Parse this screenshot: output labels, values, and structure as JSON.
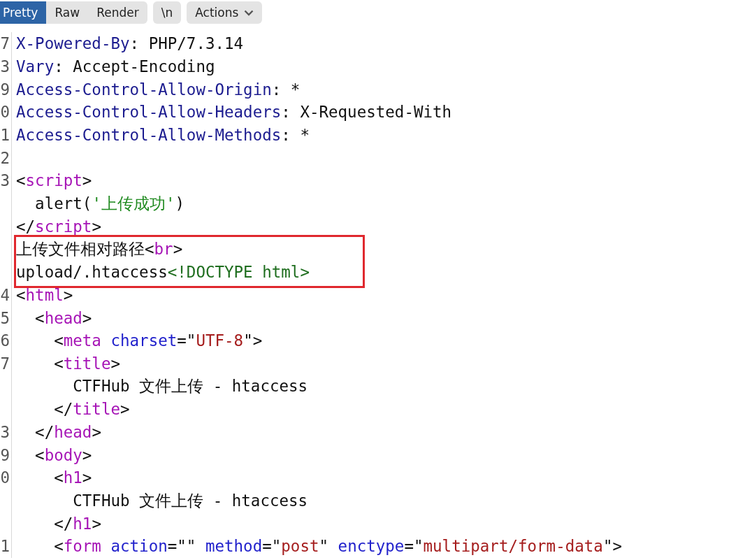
{
  "toolbar": {
    "view_tabs": [
      {
        "label": "Pretty",
        "selected": true
      },
      {
        "label": "Raw",
        "selected": false
      },
      {
        "label": "Render",
        "selected": false
      }
    ],
    "newline_button": "\\n",
    "actions_button": "Actions"
  },
  "lines": [
    {
      "number": "7",
      "boxed": false,
      "tokens": [
        {
          "kind": "header",
          "text": "X-Powered-By"
        },
        {
          "kind": "plain",
          "text": ": PHP/7.3.14"
        }
      ]
    },
    {
      "number": "3",
      "boxed": false,
      "tokens": [
        {
          "kind": "header",
          "text": "Vary"
        },
        {
          "kind": "plain",
          "text": ": Accept-Encoding"
        }
      ]
    },
    {
      "number": "9",
      "boxed": false,
      "tokens": [
        {
          "kind": "header",
          "text": "Access-Control-Allow-Origin"
        },
        {
          "kind": "plain",
          "text": ": *"
        }
      ]
    },
    {
      "number": "0",
      "boxed": false,
      "tokens": [
        {
          "kind": "header",
          "text": "Access-Control-Allow-Headers"
        },
        {
          "kind": "plain",
          "text": ": X-Requested-With"
        }
      ]
    },
    {
      "number": "1",
      "boxed": false,
      "tokens": [
        {
          "kind": "header",
          "text": "Access-Control-Allow-Methods"
        },
        {
          "kind": "plain",
          "text": ": *"
        }
      ]
    },
    {
      "number": "2",
      "boxed": false
    },
    {
      "number": "3",
      "boxed": false,
      "tokens": [
        {
          "kind": "plain",
          "text": "<"
        },
        {
          "kind": "tag",
          "text": "script"
        },
        {
          "kind": "plain",
          "text": ">"
        }
      ]
    },
    {
      "boxed": false,
      "tokens": [
        {
          "kind": "plain",
          "text": "  alert("
        },
        {
          "kind": "jsstr",
          "text": "'上传成功'"
        },
        {
          "kind": "plain",
          "text": ")"
        }
      ]
    },
    {
      "boxed": false,
      "tokens": [
        {
          "kind": "plain",
          "text": "</"
        },
        {
          "kind": "tag",
          "text": "script"
        },
        {
          "kind": "plain",
          "text": ">"
        }
      ]
    },
    {
      "boxed": true,
      "tokens": [
        {
          "kind": "plain",
          "text": "上传文件相对路径<"
        },
        {
          "kind": "tag",
          "text": "br"
        },
        {
          "kind": "plain",
          "text": ">"
        }
      ]
    },
    {
      "boxed": true,
      "tokens": [
        {
          "kind": "plain",
          "text": "upload/.htaccess"
        },
        {
          "kind": "doctype",
          "text": "<!DOCTYPE html>"
        }
      ]
    },
    {
      "number": "4",
      "boxed": false,
      "tokens": [
        {
          "kind": "plain",
          "text": "<"
        },
        {
          "kind": "tag",
          "text": "html"
        },
        {
          "kind": "plain",
          "text": ">"
        }
      ]
    },
    {
      "number": "5",
      "boxed": false,
      "tokens": [
        {
          "kind": "plain",
          "text": "  <"
        },
        {
          "kind": "tag",
          "text": "head"
        },
        {
          "kind": "plain",
          "text": ">"
        }
      ]
    },
    {
      "number": "6",
      "boxed": false,
      "tokens": [
        {
          "kind": "plain",
          "text": "    <"
        },
        {
          "kind": "tag",
          "text": "meta"
        },
        {
          "kind": "attr",
          "text": " charset"
        },
        {
          "kind": "plain",
          "text": "=\""
        },
        {
          "kind": "value",
          "text": "UTF-8"
        },
        {
          "kind": "plain",
          "text": "\">"
        }
      ]
    },
    {
      "number": "7",
      "boxed": false,
      "tokens": [
        {
          "kind": "plain",
          "text": "    <"
        },
        {
          "kind": "tag",
          "text": "title"
        },
        {
          "kind": "plain",
          "text": ">"
        }
      ]
    },
    {
      "boxed": false,
      "tokens": [
        {
          "kind": "plain",
          "text": "      CTFHub 文件上传 - htaccess"
        }
      ]
    },
    {
      "boxed": false,
      "tokens": [
        {
          "kind": "plain",
          "text": "    </"
        },
        {
          "kind": "tag",
          "text": "title"
        },
        {
          "kind": "plain",
          "text": ">"
        }
      ]
    },
    {
      "number": "3",
      "boxed": false,
      "tokens": [
        {
          "kind": "plain",
          "text": "  </"
        },
        {
          "kind": "tag",
          "text": "head"
        },
        {
          "kind": "plain",
          "text": ">"
        }
      ]
    },
    {
      "number": "9",
      "boxed": false,
      "tokens": [
        {
          "kind": "plain",
          "text": "  <"
        },
        {
          "kind": "tag",
          "text": "body"
        },
        {
          "kind": "plain",
          "text": ">"
        }
      ]
    },
    {
      "number": "0",
      "boxed": false,
      "tokens": [
        {
          "kind": "plain",
          "text": "    <"
        },
        {
          "kind": "tag",
          "text": "h1"
        },
        {
          "kind": "plain",
          "text": ">"
        }
      ]
    },
    {
      "boxed": false,
      "tokens": [
        {
          "kind": "plain",
          "text": "      CTFHub 文件上传 - htaccess"
        }
      ]
    },
    {
      "boxed": false,
      "tokens": [
        {
          "kind": "plain",
          "text": "    </"
        },
        {
          "kind": "tag",
          "text": "h1"
        },
        {
          "kind": "plain",
          "text": ">"
        }
      ]
    },
    {
      "number": "1",
      "boxed": false,
      "tokens": [
        {
          "kind": "plain",
          "text": "    <"
        },
        {
          "kind": "tag",
          "text": "form"
        },
        {
          "kind": "attr",
          "text": " action"
        },
        {
          "kind": "plain",
          "text": "=\"\" "
        },
        {
          "kind": "attr",
          "text": "method"
        },
        {
          "kind": "plain",
          "text": "=\""
        },
        {
          "kind": "value",
          "text": "post"
        },
        {
          "kind": "plain",
          "text": "\" "
        },
        {
          "kind": "attr",
          "text": "enctype"
        },
        {
          "kind": "plain",
          "text": "=\""
        },
        {
          "kind": "value",
          "text": "multipart/form-data"
        },
        {
          "kind": "plain",
          "text": "\">"
        }
      ]
    }
  ]
}
